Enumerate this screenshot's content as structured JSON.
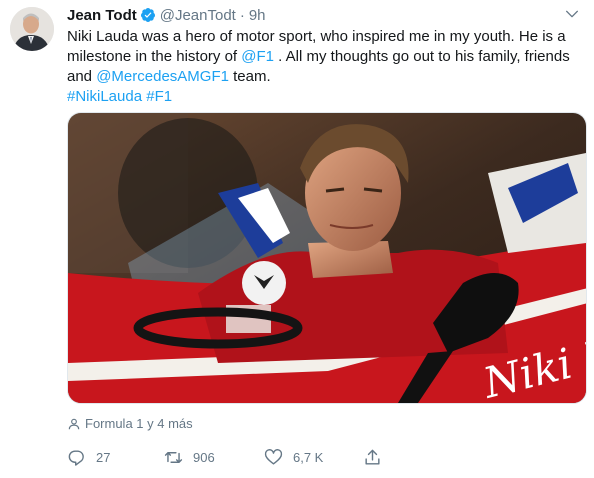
{
  "tweet": {
    "author_name": "Jean Todt",
    "author_handle": "@JeanTodt",
    "separator": "·",
    "time": "9h",
    "text_lines": [
      [
        "Niki Lauda was a hero of motor sport, who inspired me in my youth. He is a"
      ],
      [
        "milestone in the history of ",
        "@F1",
        " . All my thoughts go out to his family, friends"
      ],
      [
        "and ",
        "@MercedesAMGF1",
        " team."
      ],
      [
        "#NikiLauda #F1"
      ]
    ],
    "text": {
      "l1": "Niki Lauda was a hero of motor sport, who inspired me in my youth. He is a",
      "l2_a": "milestone in the history of ",
      "l2_mention": "@F1",
      "l2_b": " . All my thoughts go out to his family, friends",
      "l3_a": "and ",
      "l3_mention": "@MercedesAMGF1",
      "l3_b": " team.",
      "hashtag1": "#NikiLauda",
      "hashtag2": "#F1"
    },
    "media_tags": "Formula 1 y 4 más",
    "image_text": "Niki Lau",
    "actions": {
      "reply_count": "27",
      "retweet_count": "906",
      "like_count": "6,7 K"
    }
  },
  "colors": {
    "link": "#1da1f2",
    "muted": "#657786",
    "verified": "#1da1f2",
    "car_red": "#c8161d"
  },
  "icons": [
    "verified-badge-icon",
    "chevron-down-icon",
    "person-tag-icon",
    "reply-icon",
    "retweet-icon",
    "like-icon",
    "share-icon"
  ]
}
